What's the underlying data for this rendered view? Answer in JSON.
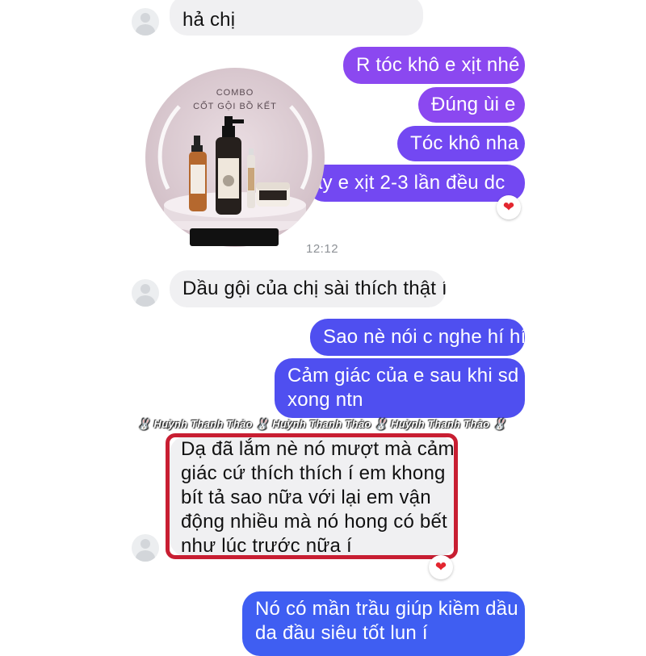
{
  "product_image": {
    "line1": "COMBO",
    "line2": "CỐT GỘI BỒ KẾT"
  },
  "messages": {
    "m1": "hả chị",
    "m2": "R tóc khô e xịt nhé",
    "m3": "Đúng ùi e",
    "m4": "Tóc khô nha",
    "m5": "ày e xịt 2-3 lần đều dc",
    "time": "12:12",
    "m6": "Dầu gội của chị sài thích thật í",
    "m7": "Sao nè nói c nghe hí hí",
    "m8_line1": "Cảm giác của e sau khi sd",
    "m8_line2": "xong ntn",
    "m9_line1": "Dạ đã lắm nè nó mượt mà cảm",
    "m9_line2": "giác cứ thích thích í em khong",
    "m9_line3": "bít tả sao nữa với lại em vận",
    "m9_line4": "động nhiều mà nó hong có bết",
    "m9_line5": "như lúc trước nữa í",
    "m10_line1": "Nó có mần trầu giúp kiềm dầu",
    "m10_line2": "da đầu siêu tốt lun í"
  },
  "watermark": "🐰 Huỳnh Thanh Thảo 🐰 Huỳnh Thanh Thảo 🐰 Huỳnh Thanh Thảo 🐰",
  "reactions": {
    "heart": "❤"
  },
  "colors": {
    "incoming_bubble": "#f0f0f2",
    "outgoing_purple": "#8b48f0",
    "outgoing_violet": "#7348f2",
    "outgoing_indigo": "#4f4ff0",
    "outgoing_blue": "#3f5ef2",
    "highlight_border": "#c81e32"
  }
}
